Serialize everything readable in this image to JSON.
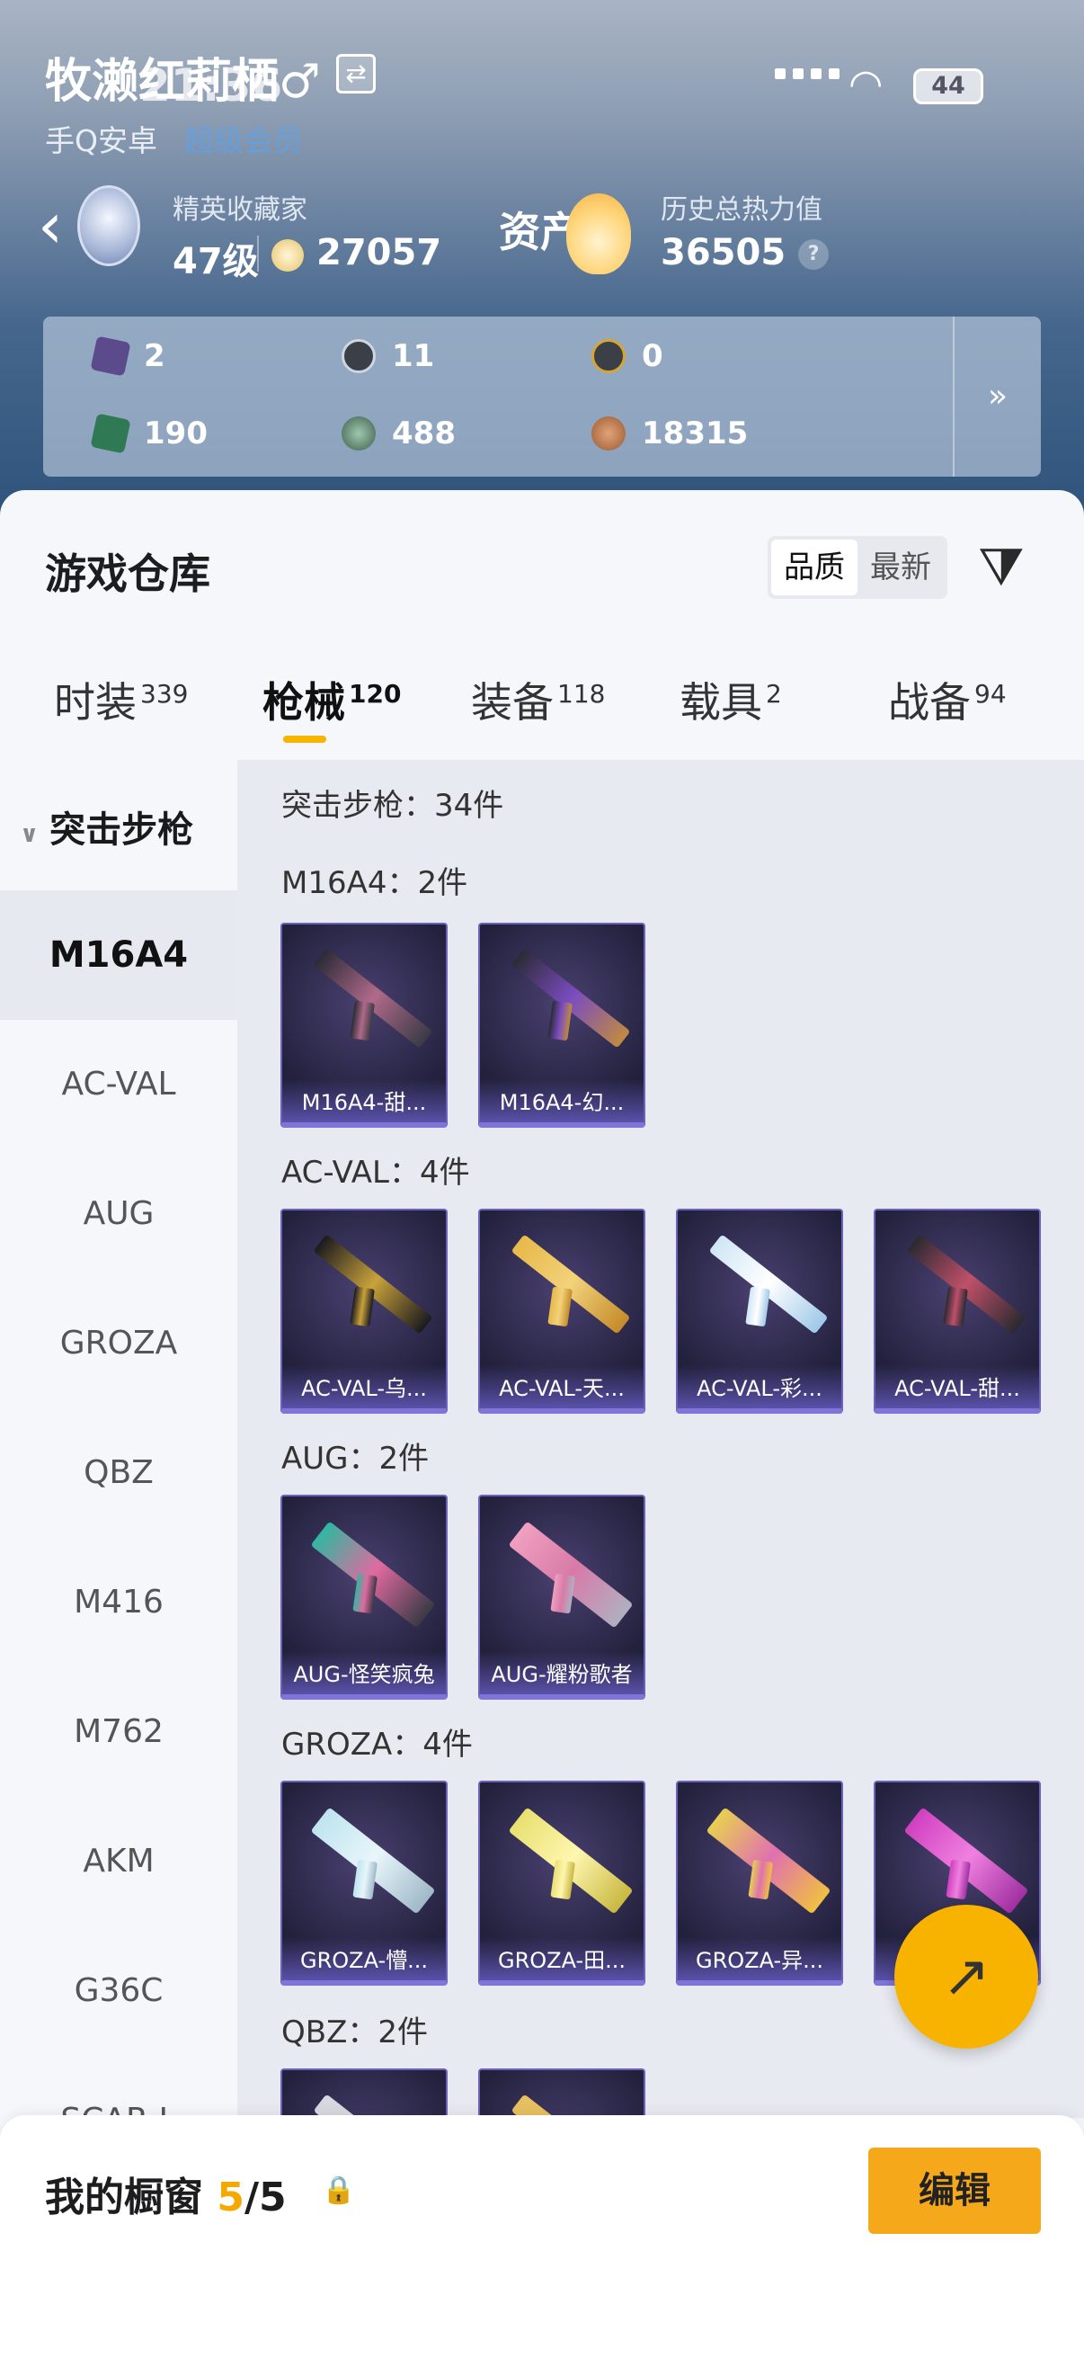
{
  "status": {
    "time": "21:36",
    "battery": "44"
  },
  "profile": {
    "name": "牧濑红莉栖",
    "gender_symbol": "♂",
    "swap_symbol": "⇄",
    "platform": "手Q安卓",
    "platform_note": "超级会员",
    "collector_label": "精英收藏家",
    "level": "47级",
    "points": "27057",
    "assets_label": "资产",
    "heat_label": "历史总热力值",
    "heat_value": "36505",
    "heat_help": "?"
  },
  "stats": [
    {
      "icon": "card-icon",
      "value": "2",
      "color": "#5b4a8c"
    },
    {
      "icon": "s-coin-icon",
      "value": "11",
      "color": "#3a3f48"
    },
    {
      "icon": "gold-coin-icon",
      "value": "0",
      "color": "#d9a531"
    },
    {
      "icon": "green-card-icon",
      "value": "190",
      "color": "#2f7a55"
    },
    {
      "icon": "orb-icon",
      "value": "488",
      "color": "#3d5e4a"
    },
    {
      "icon": "bronze-coin-icon",
      "value": "18315",
      "color": "#9a5a2f"
    }
  ],
  "stats_more": "»",
  "warehouse": {
    "title": "游戏仓库",
    "sort_quality": "品质",
    "sort_latest": "最新",
    "filter_icon": "filter-icon"
  },
  "tabs": [
    {
      "label": "时装",
      "count": "339"
    },
    {
      "label": "枪械",
      "count": "120"
    },
    {
      "label": "装备",
      "count": "118"
    },
    {
      "label": "载具",
      "count": "2"
    },
    {
      "label": "战备",
      "count": "94"
    }
  ],
  "sidebar": {
    "category": "突击步枪",
    "items": [
      "M16A4",
      "AC-VAL",
      "AUG",
      "GROZA",
      "QBZ",
      "M416",
      "M762",
      "AKM",
      "G36C",
      "SCAR-L"
    ]
  },
  "content": {
    "summary": "突击步枪：34件",
    "groups": [
      {
        "title": "M16A4：2件",
        "items": [
          "M16A4-甜...",
          "M16A4-幻..."
        ]
      },
      {
        "title": "AC-VAL：4件",
        "items": [
          "AC-VAL-乌...",
          "AC-VAL-天...",
          "AC-VAL-彩...",
          "AC-VAL-甜..."
        ]
      },
      {
        "title": "AUG：2件",
        "items": [
          "AUG-怪笑疯兔",
          "AUG-耀粉歌者"
        ]
      },
      {
        "title": "GROZA：4件",
        "items": [
          "GROZA-懵...",
          "GROZA-田...",
          "GROZA-异...",
          "G..."
        ]
      },
      {
        "title": "QBZ：2件",
        "items": [
          "",
          ""
        ]
      }
    ]
  },
  "fab_icon": "↗",
  "showcase": {
    "label": "我的橱窗",
    "used": "5",
    "sep": "/",
    "total": "5",
    "lock": "🔒",
    "edit": "编辑"
  }
}
